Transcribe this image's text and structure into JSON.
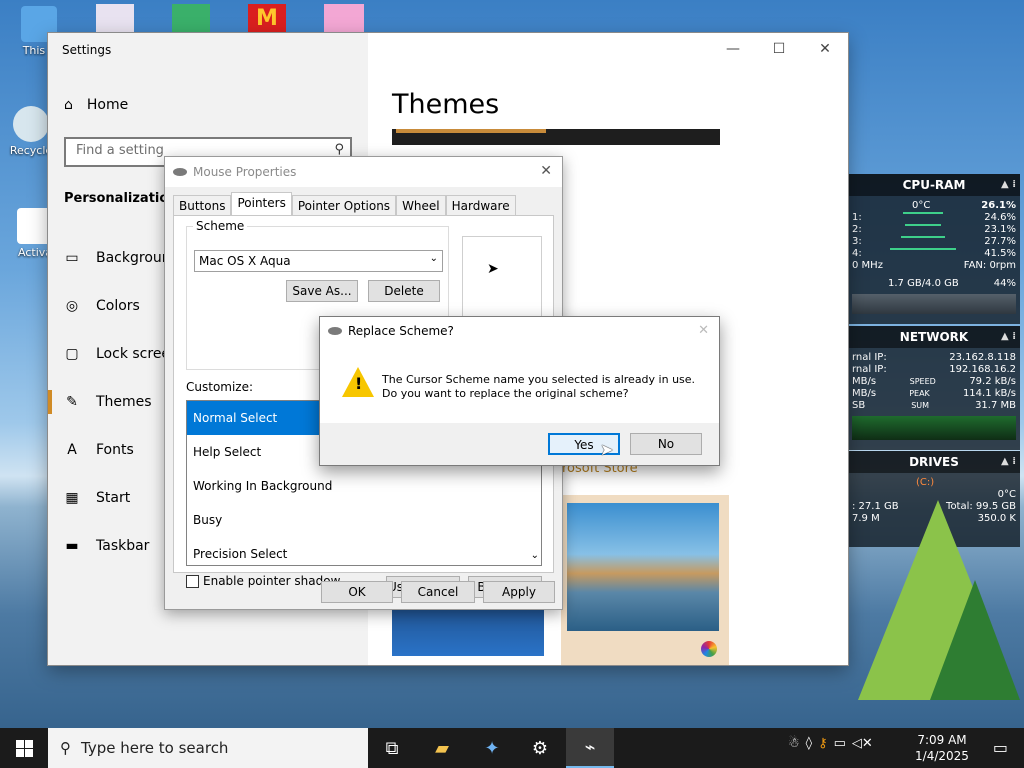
{
  "desktop": {
    "icons": [
      {
        "label": "This P",
        "icon": "computer-icon"
      },
      {
        "label": "Recycle",
        "icon": "recycle-bin-icon"
      },
      {
        "label": "Activa",
        "icon": "file-icon"
      }
    ]
  },
  "widgets": {
    "cpu": {
      "title": "CPU-RAM",
      "temp": "0°C",
      "total": "26.1%",
      "cores": [
        {
          "label": "1:",
          "value": "24.6%"
        },
        {
          "label": "2:",
          "value": "23.1%"
        },
        {
          "label": "3:",
          "value": "27.7%"
        },
        {
          "label": "4:",
          "value": "41.5%"
        }
      ],
      "freq": "0 MHz",
      "fan": "FAN: 0rpm",
      "ram": "1.7 GB/4.0 GB",
      "ram_pct": "44%"
    },
    "network": {
      "title": "NETWORK",
      "ext_ip_label": "rnal IP:",
      "ext_ip": "23.162.8.118",
      "int_ip_label": "rnal IP:",
      "int_ip": "192.168.16.2",
      "speed_label": "SPEED",
      "speed": "79.2 kB/s",
      "peak_label": "PEAK",
      "peak": "114.1 kB/s",
      "sum_label": "SUM",
      "sum": "31.7 MB",
      "left1": "MB/s",
      "left2": "MB/s",
      "left3": "SB"
    },
    "drives": {
      "title": "DRIVES",
      "drive": "(C:)",
      "temp": "0°C",
      "used": ": 27.1 GB",
      "total": "Total: 99.5 GB",
      "read": "7.9 M",
      "write": "350.0 K"
    }
  },
  "settings": {
    "window_title": "Settings",
    "home_label": "Home",
    "search_placeholder": "Find a setting",
    "category": "Personalization",
    "nav": [
      {
        "label": "Backgroun",
        "icon": "background-icon"
      },
      {
        "label": "Colors",
        "icon": "palette-icon"
      },
      {
        "label": "Lock screen",
        "icon": "lock-screen-icon"
      },
      {
        "label": "Themes",
        "icon": "themes-icon",
        "active": true
      },
      {
        "label": "Fonts",
        "icon": "fonts-icon"
      },
      {
        "label": "Start",
        "icon": "start-icon"
      },
      {
        "label": "Taskbar",
        "icon": "taskbar-icon"
      }
    ],
    "page_title": "Themes",
    "store_link": "rosoft Store"
  },
  "mouse_dialog": {
    "title": "Mouse Properties",
    "tabs": [
      "Buttons",
      "Pointers",
      "Pointer Options",
      "Wheel",
      "Hardware"
    ],
    "active_tab": "Pointers",
    "scheme_label": "Scheme",
    "scheme_value": "Mac OS X Aqua",
    "save_as": "Save As...",
    "delete": "Delete",
    "customize_label": "Customize:",
    "cursors": [
      "Normal Select",
      "Help Select",
      "Working In Background",
      "Busy",
      "Precision Select"
    ],
    "selected_cursor": "Normal Select",
    "shadow_label": "Enable pointer shadow",
    "use_default": "Use Default",
    "browse": "Browse...",
    "ok": "OK",
    "cancel": "Cancel",
    "apply": "Apply"
  },
  "replace_dialog": {
    "title": "Replace Scheme?",
    "message": "The Cursor Scheme name you selected is already in use.  Do you want to replace the original scheme?",
    "yes": "Yes",
    "no": "No"
  },
  "taskbar": {
    "search_placeholder": "Type here to search",
    "time": "7:09 AM",
    "date": "1/4/2025"
  }
}
